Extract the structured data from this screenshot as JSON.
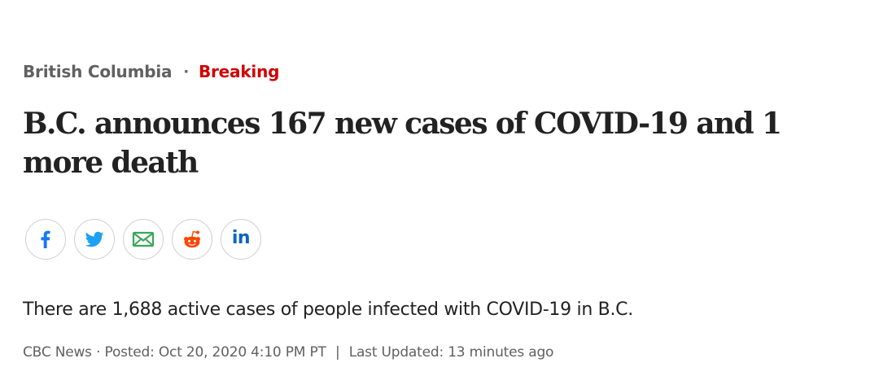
{
  "kicker": {
    "section": "British Columbia",
    "separator": "·",
    "label": "Breaking"
  },
  "headline": "B.C. announces 167 new cases of COVID-19 and 1 more death",
  "share": {
    "buttons": [
      {
        "network": "facebook",
        "icon": "facebook-icon",
        "color": "#1877f2"
      },
      {
        "network": "twitter",
        "icon": "twitter-icon",
        "color": "#1da1f2"
      },
      {
        "network": "email",
        "icon": "email-icon",
        "color": "#3aa757"
      },
      {
        "network": "reddit",
        "icon": "reddit-icon",
        "color": "#ff4500"
      },
      {
        "network": "linkedin",
        "icon": "linkedin-icon",
        "color": "#0a66c2",
        "glyph": "in"
      }
    ]
  },
  "deck": "There are 1,688 active cases of people infected with COVID-19 in B.C.",
  "byline": {
    "source": "CBC News",
    "dot": "·",
    "posted": "Posted: Oct 20, 2020 4:10 PM PT",
    "pipe": "|",
    "updated": "Last Updated: 13 minutes ago"
  },
  "colors": {
    "breaking": "#d10000",
    "text": "#222222",
    "muted": "#616161"
  }
}
